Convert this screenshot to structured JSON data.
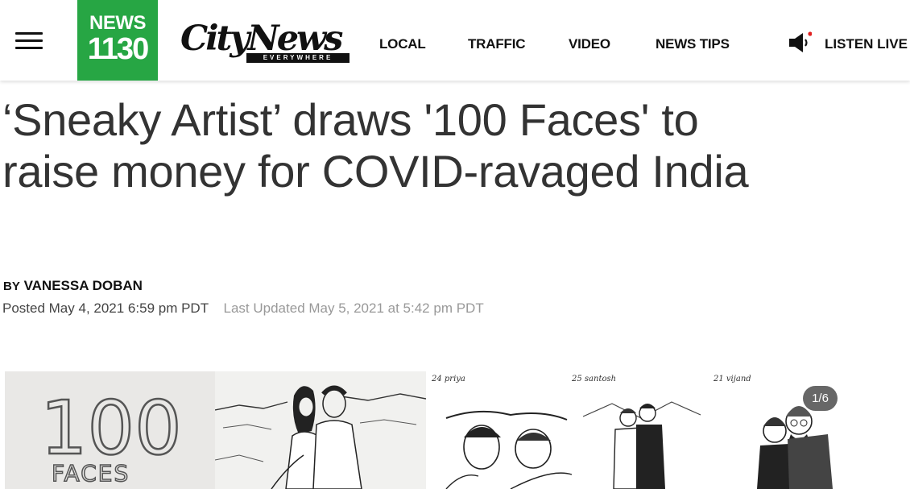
{
  "header": {
    "logo_line1": "NEWS",
    "logo_line2": "1130",
    "citynews_wordmark": "CityNews",
    "citynews_tagline": "EVERYWHERE",
    "nav": [
      "LOCAL",
      "TRAFFIC",
      "VIDEO",
      "NEWS TIPS"
    ],
    "listen_live": "LISTEN LIVE",
    "icons": [
      "hamburger-menu-icon",
      "speaker-icon"
    ],
    "colors": {
      "brand_green": "#27a644",
      "live_dot": "#e02020"
    }
  },
  "article": {
    "headline": "‘Sneaky Artist’ draws '100 Faces' to raise money for COVID-ravaged India",
    "byline_prefix": "BY",
    "author": "VANESSA DOBAN",
    "posted": "Posted May 4, 2021 6:59 pm PDT",
    "updated": "Last Updated May 5, 2021 at 5:42 pm PDT"
  },
  "gallery": {
    "counter": "1/6",
    "panel1_title_number": "100",
    "panel1_title_word": "FACES",
    "sketch_labels": [
      "24 priya",
      "25 santosh",
      "21 vijand"
    ]
  }
}
